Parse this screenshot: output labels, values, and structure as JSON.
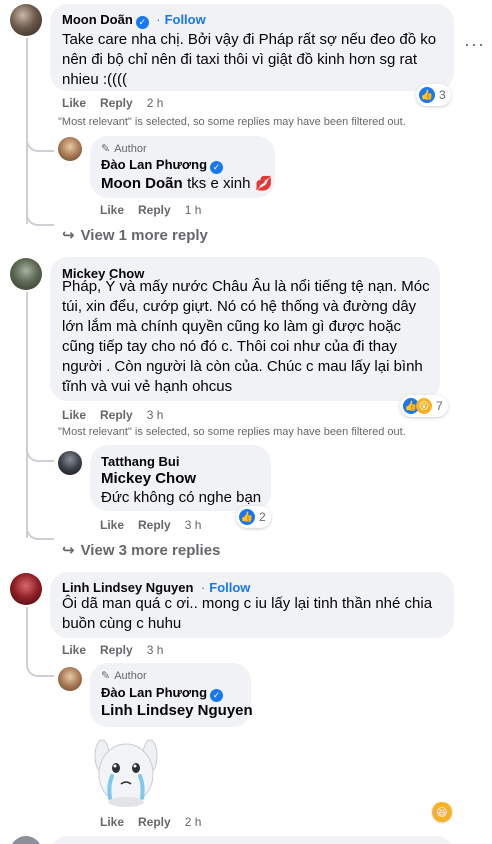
{
  "comments": [
    {
      "name": "Moon Doãn",
      "follow": "Follow",
      "separator": "·",
      "text": "Take care nha chị. Bởi vậy đi Pháp rất sợ nếu đeo đồ ko nên đi bộ chỉ nên đi taxi thôi vì giật đồ kinh hơn sg rat nhieu :((((",
      "like": "Like",
      "reply": "Reply",
      "time": "2 h",
      "reaction_count": "3",
      "notice": "\"Most relevant\" is selected, so some replies may have been filtered out."
    },
    {
      "name": "Mickey Chow",
      "text": "Pháp, Ý và mấy nước Châu Âu là nổi tiếng tệ nạn. Móc túi, xin đểu, cướp giựt. Nó có hệ thống và đường dây lớn lắm mà chính quyền cũng ko làm gì được hoặc cũng tiếp tay cho nó đó c. Thôi coi như của đi thay người . Còn người là còn của. Chúc c mau lấy lại bình tĩnh và vui vẻ hạnh ohcus",
      "like": "Like",
      "reply": "Reply",
      "time": "3 h",
      "reaction_count": "7",
      "notice": "\"Most relevant\" is selected, so some replies may have been filtered out."
    },
    {
      "name": "Linh Lindsey Nguyen",
      "follow": "Follow",
      "separator": "·",
      "text": "Ôi dã man quá c ơi.. mong c iu lấy lại tinh thần nhé chia buồn cùng c huhu",
      "like": "Like",
      "reply": "Reply",
      "time": "3 h"
    }
  ],
  "replies": [
    {
      "author_label": "Author",
      "name": "Đào Lan Phương",
      "tag": "Moon Doãn",
      "text": "tks e xinh",
      "like": "Like",
      "reply": "Reply",
      "time": "1 h"
    },
    {
      "name": "Tatthang Bui",
      "tag": "Mickey Chow",
      "text": "Đức không có nghe bạn",
      "like": "Like",
      "reply": "Reply",
      "time": "3 h",
      "reaction_count": "2"
    },
    {
      "author_label": "Author",
      "name": "Đào Lan Phương",
      "tag": "Linh Lindsey Nguyen",
      "like": "Like",
      "reply": "Reply",
      "time": "2 h"
    }
  ],
  "view_more": {
    "first": "View 1 more reply",
    "second": "View 3 more replies"
  },
  "colors": {
    "accent": "#1877f2",
    "bubble": "#f0f2f5",
    "muted": "#65676b"
  }
}
